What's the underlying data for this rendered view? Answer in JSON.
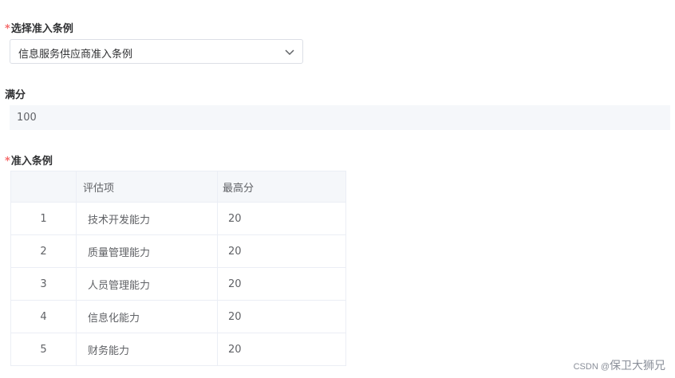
{
  "form": {
    "condition_select": {
      "label": "选择准入条例",
      "required_mark": "*",
      "value": "信息服务供应商准入条例"
    },
    "full_score": {
      "label": "满分",
      "value": "100"
    },
    "conditions_table": {
      "label": "准入条例",
      "required_mark": "*",
      "columns": [
        "",
        "评估项",
        "最高分"
      ],
      "rows": [
        {
          "index": "1",
          "item": "技术开发能力",
          "max": "20"
        },
        {
          "index": "2",
          "item": "质量管理能力",
          "max": "20"
        },
        {
          "index": "3",
          "item": "人员管理能力",
          "max": "20"
        },
        {
          "index": "4",
          "item": "信息化能力",
          "max": "20"
        },
        {
          "index": "5",
          "item": "财务能力",
          "max": "20"
        }
      ]
    }
  },
  "watermark": {
    "prefix": "CSDN @",
    "name": "保卫大狮兄"
  },
  "colors": {
    "required": "#f56c6c",
    "border": "#dcdfe6",
    "readonly_bg": "#f5f7fa"
  }
}
